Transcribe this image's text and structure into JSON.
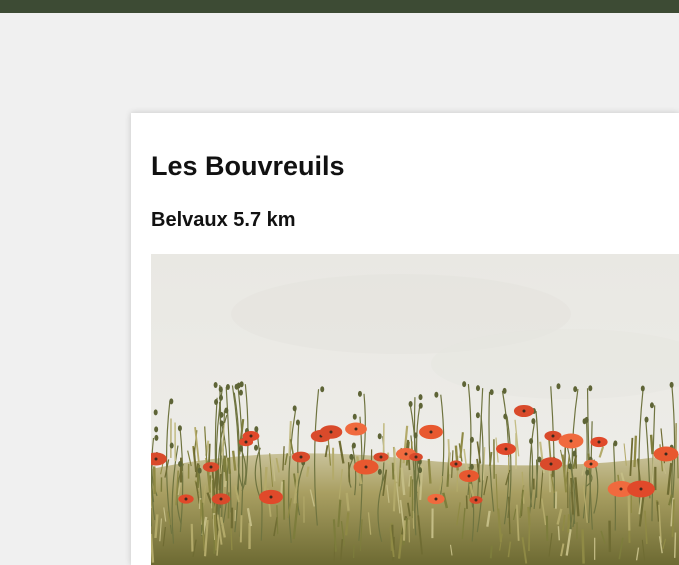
{
  "listing": {
    "title": "Les Bouvreuils",
    "subtitle": "Belvaux 5.7 km",
    "photo_icon": "field-of-poppies-photo"
  },
  "colors": {
    "topbar": "#3d4b34",
    "page_background": "#f0f0f0",
    "card_background": "#ffffff"
  }
}
